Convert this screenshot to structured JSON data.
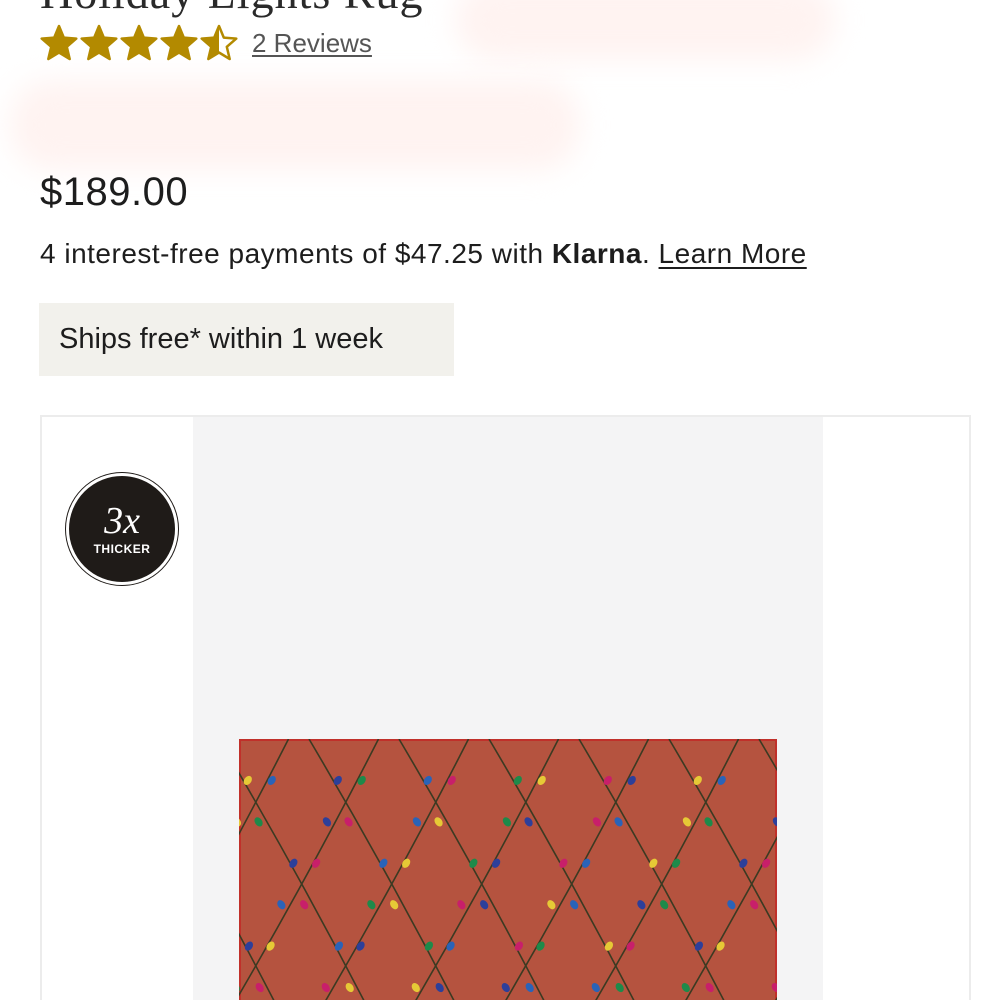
{
  "product": {
    "title_fragment": "Holiday Lights Rug",
    "rating": {
      "stars": 4.5,
      "max": 5,
      "star_color": "#b38a00",
      "reviews_label": "2 Reviews"
    },
    "price": "$189.00",
    "financing": {
      "text": "4 interest-free payments of $47.25 with",
      "brand": "Klarna",
      "suffix": ".",
      "link": "Learn More"
    },
    "shipping_badge": "Ships free* within 1 week"
  },
  "gallery": {
    "badge": {
      "big": "3x",
      "small": "THICKER"
    },
    "rug_colors": {
      "base": "#b5533f",
      "vine": "#3b3a22",
      "bulbs": [
        "#2a63b8",
        "#1e8a4a",
        "#c81f6a",
        "#e6c936",
        "#2d3f9a"
      ]
    },
    "image_alt_icon": "rug-image"
  }
}
